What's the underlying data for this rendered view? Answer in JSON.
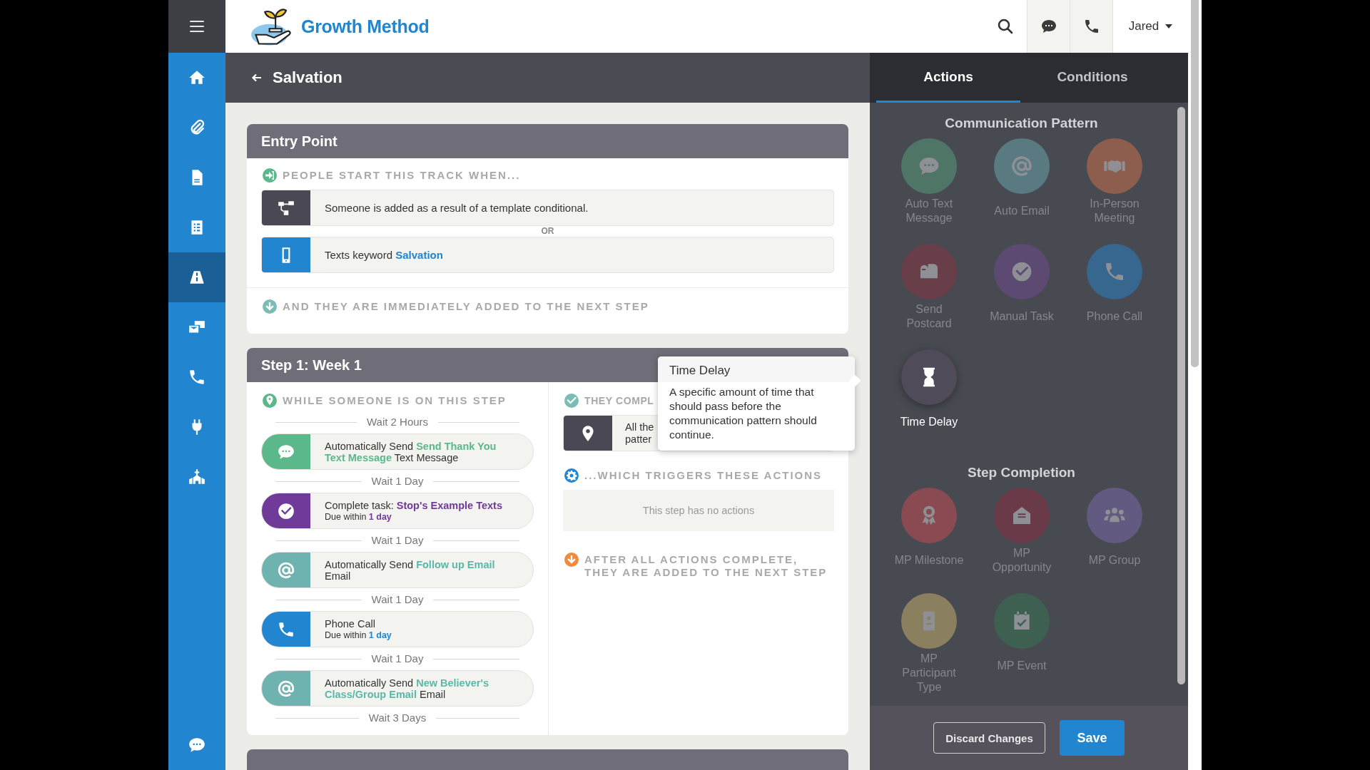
{
  "header": {
    "logo": "Growth Method",
    "user": "Jared"
  },
  "sidebar": {
    "items": [
      {
        "kind": "home",
        "selected": false
      },
      {
        "kind": "paperclip",
        "selected": false
      },
      {
        "kind": "file",
        "selected": false
      },
      {
        "kind": "list",
        "selected": false
      },
      {
        "kind": "road",
        "selected": true
      },
      {
        "kind": "mailcard",
        "selected": false
      },
      {
        "kind": "phone",
        "selected": false
      },
      {
        "kind": "plug",
        "selected": false
      },
      {
        "kind": "church",
        "selected": false
      }
    ],
    "bottom": {
      "kind": "chat",
      "selected": false
    }
  },
  "page": {
    "title": "Salvation"
  },
  "entry": {
    "title": "Entry Point",
    "start_heading": "PEOPLE START THIS TRACK WHEN...",
    "triggers": [
      {
        "kind": "conditional",
        "text": "Someone is added as a result of a template conditional."
      },
      {
        "kind": "keyword",
        "text": "Texts keyword ",
        "keyword": "Salvation"
      }
    ],
    "separator": "OR",
    "next_heading": "AND THEY ARE IMMEDIATELY ADDED TO THE NEXT STEP"
  },
  "step": {
    "title": "Step 1: Week 1",
    "while_heading": "WHILE SOMEONE IS ON THIS STEP",
    "timeline": [
      {
        "kind": "wait",
        "text": "Wait 2 Hours"
      },
      {
        "kind": "sms",
        "prefix": "Automatically Send ",
        "link": "Send Thank You Text Message",
        "suffix": " Text Message"
      },
      {
        "kind": "wait",
        "text": "Wait 1 Day"
      },
      {
        "kind": "task",
        "prefix": "Complete task: ",
        "link": "Stop's Example Texts",
        "sub": "Due within ",
        "sub_link": "1 day"
      },
      {
        "kind": "wait",
        "text": "Wait 1 Day"
      },
      {
        "kind": "email",
        "prefix": "Automatically Send ",
        "link": "Follow up Email",
        "suffix": " Email"
      },
      {
        "kind": "wait",
        "text": "Wait 1 Day"
      },
      {
        "kind": "phone",
        "prefix": "Phone Call",
        "sub": "Due within ",
        "sub_link": "1 day"
      },
      {
        "kind": "wait",
        "text": "Wait 1 Day"
      },
      {
        "kind": "email",
        "prefix": "Automatically Send ",
        "link": "New Believer's Class/Group Email",
        "suffix": " Email"
      },
      {
        "kind": "wait",
        "text": "Wait 3 Days"
      }
    ],
    "complete_heading": "THEY COMPL",
    "condition": {
      "line_1": "All the",
      "line_2": "patter"
    },
    "triggers_heading": "...WHICH TRIGGERS THESE ACTIONS",
    "empty": "This step has no actions",
    "after_heading": "AFTER ALL ACTIONS COMPLETE, THEY ARE ADDED TO THE NEXT STEP"
  },
  "tooltip": {
    "title": "Time Delay",
    "text": "A specific amount of time that should pass before the communication pattern should continue."
  },
  "panel": {
    "tabs": [
      {
        "label": "Actions",
        "selected": true
      },
      {
        "label": "Conditions",
        "selected": false
      }
    ],
    "sections": [
      {
        "title": "Communication Pattern",
        "items": [
          {
            "kind": "sms",
            "label": "Auto Text Message",
            "color": "#4e7566",
            "highlighted": false
          },
          {
            "kind": "at",
            "label": "Auto Email",
            "color": "#587a80",
            "highlighted": false
          },
          {
            "kind": "handshake",
            "label": "In-Person Meeting",
            "color": "#8d5e4e",
            "highlighted": false
          },
          {
            "kind": "mailbox",
            "label": "Send Postcard",
            "color": "#683e48",
            "highlighted": false
          },
          {
            "kind": "check",
            "label": "Manual Task",
            "color": "#5c4a72",
            "highlighted": false
          },
          {
            "kind": "phone",
            "label": "Phone Call",
            "color": "#37678f",
            "highlighted": false
          },
          {
            "kind": "hourglass",
            "label": "Time Delay",
            "color": "#4f4b58",
            "highlighted": true
          }
        ]
      },
      {
        "title": "Step Completion",
        "items": [
          {
            "kind": "award",
            "label": "MP Milestone",
            "color": "#8a4a52",
            "highlighted": false
          },
          {
            "kind": "envelope",
            "label": "MP Opportunity",
            "color": "#6a3a48",
            "highlighted": false
          },
          {
            "kind": "users",
            "label": "MP Group",
            "color": "#625a80",
            "highlighted": false
          },
          {
            "kind": "idbadge",
            "label": "MP Participant Type",
            "color": "#8a8060",
            "highlighted": false
          },
          {
            "kind": "calendar",
            "label": "MP Event",
            "color": "#3e6050",
            "highlighted": false
          }
        ]
      }
    ],
    "buttons": [
      {
        "kind": "secondary",
        "label": "Discard Changes"
      },
      {
        "kind": "primary",
        "label": "Save"
      }
    ]
  }
}
